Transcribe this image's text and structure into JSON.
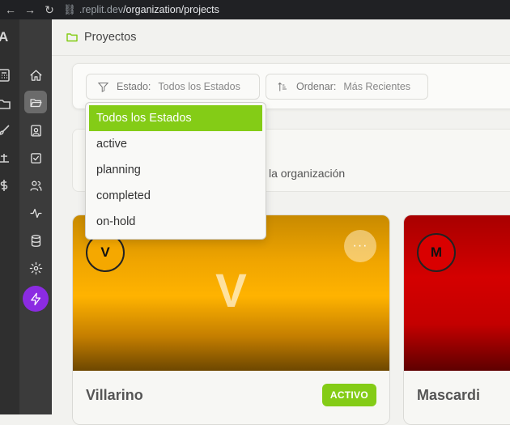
{
  "browser": {
    "url_host": ".replit.dev",
    "url_path": "/organization/projects"
  },
  "outer_rail": {
    "brand": "A"
  },
  "sidebar": {
    "items": [
      {
        "name": "home",
        "active": false
      },
      {
        "name": "folder-open",
        "active": true
      },
      {
        "name": "contact-card",
        "active": false
      },
      {
        "name": "checkbox",
        "active": false
      },
      {
        "name": "users",
        "active": false
      },
      {
        "name": "activity",
        "active": false
      },
      {
        "name": "database",
        "active": false
      },
      {
        "name": "gear",
        "active": false
      },
      {
        "name": "bolt",
        "active": false
      }
    ]
  },
  "header": {
    "title": "Proyectos"
  },
  "filters": {
    "status_label": "Estado:",
    "status_value": "Todos los Estados",
    "sort_label": "Ordenar:",
    "sort_value": "Más Recientes"
  },
  "panel": {
    "partial_text": "la organización"
  },
  "dropdown": {
    "options": [
      "Todos los Estados",
      "active",
      "planning",
      "completed",
      "on-hold"
    ],
    "selected_index": 0
  },
  "cards": [
    {
      "initial": "V",
      "big_letter": "V",
      "name": "Villarino",
      "status": "ACTIVO",
      "more": "···"
    },
    {
      "initial": "M",
      "name": "Mascardi"
    }
  ],
  "colors": {
    "accent": "#84cc16",
    "bolt": "#8b2be2",
    "card1_gold": "#f5a800",
    "card2_red": "#d40000"
  }
}
